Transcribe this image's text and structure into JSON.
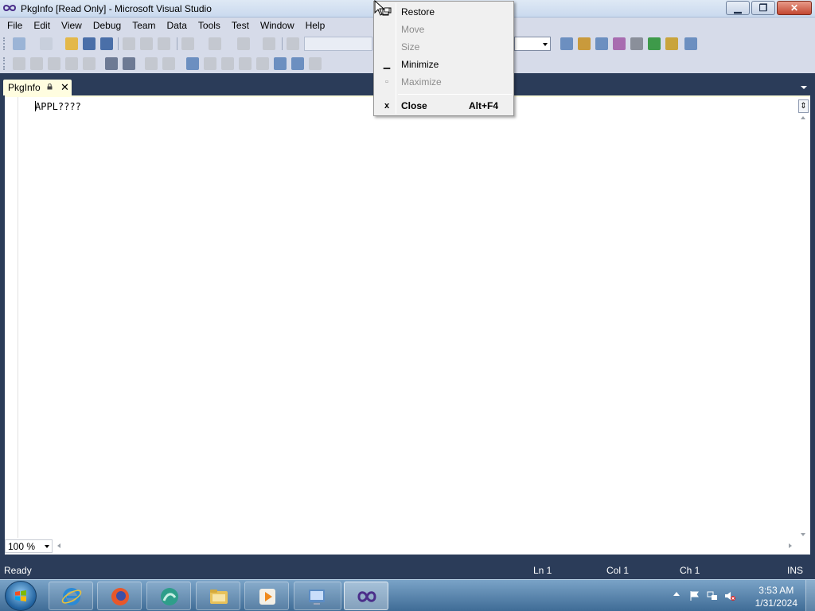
{
  "window": {
    "title": "PkgInfo [Read Only] - Microsoft Visual Studio",
    "app_icon": "visual-studio-infinity-icon",
    "min_icon": "minimize-icon",
    "max_icon": "restore-icon",
    "close_icon": "close-icon"
  },
  "menubar": {
    "items": [
      "File",
      "Edit",
      "View",
      "Debug",
      "Team",
      "Data",
      "Tools",
      "Test",
      "Window",
      "Help"
    ]
  },
  "tab": {
    "label": "PkgInfo",
    "lock_icon": "lock-icon",
    "close_glyph": "✕"
  },
  "editor": {
    "line1": "APPL????",
    "zoom": "100 %",
    "split_glyph": "⇕"
  },
  "system_menu": {
    "items": [
      {
        "label": "Restore",
        "enabled": true,
        "icon": "restore-icon"
      },
      {
        "label": "Move",
        "enabled": false,
        "icon": ""
      },
      {
        "label": "Size",
        "enabled": false,
        "icon": ""
      },
      {
        "label": "Minimize",
        "enabled": true,
        "icon": "minimize-icon"
      },
      {
        "label": "Maximize",
        "enabled": false,
        "icon": "maximize-icon"
      },
      {
        "label": "Close",
        "enabled": true,
        "icon": "close-x-icon",
        "shortcut": "Alt+F4"
      }
    ],
    "minimize_glyph": "▁",
    "maximize_glyph": "▫",
    "close_glyph": "x"
  },
  "statusbar": {
    "ready": "Ready",
    "line": "Ln 1",
    "col": "Col 1",
    "ch": "Ch 1",
    "mode": "INS"
  },
  "taskbar": {
    "apps": [
      "internet-explorer",
      "firefox",
      "media-app",
      "file-explorer",
      "media-player",
      "control-panel",
      "visual-studio"
    ],
    "time": "3:53 AM",
    "date": "1/31/2024"
  },
  "colors": {
    "chrome": "#d6dbe9",
    "dark_blue": "#2b3c59",
    "tab_active": "#fffde0"
  }
}
